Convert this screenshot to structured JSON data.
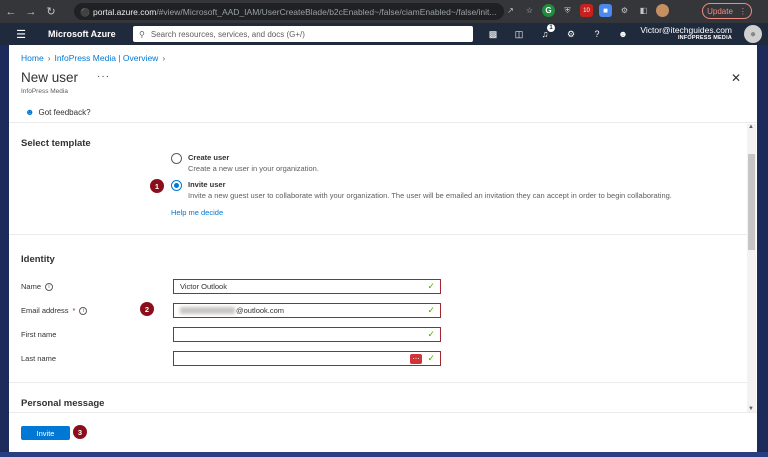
{
  "browser": {
    "url_host": "portal.azure.com",
    "url_path": "/#view/Microsoft_AAD_IAM/UserCreateBlade/b2cEnabled~/false/ciamEnabled~/false/init...",
    "update_label": "Update",
    "ext_badge": "10"
  },
  "azure": {
    "brand": "Microsoft Azure",
    "search_placeholder": "Search resources, services, and docs (G+/)",
    "notifications_count": "1",
    "account_email": "Victor@itechguides.com",
    "account_tenant": "INFOPRESS MEDIA"
  },
  "breadcrumb": [
    "Home",
    "InfoPress Media | Overview"
  ],
  "page": {
    "title": "New user",
    "subtitle": "InfoPress Media",
    "feedback_label": "Got feedback?"
  },
  "template": {
    "section_title": "Select template",
    "options": [
      {
        "label": "Create user",
        "description": "Create a new user in your organization.",
        "checked": false
      },
      {
        "label": "Invite user",
        "description": "Invite a new guest user to collaborate with your organization. The user will be emailed an invitation they can accept in order to begin collaborating.",
        "checked": true
      }
    ],
    "help_link": "Help me decide"
  },
  "identity": {
    "section_title": "Identity",
    "fields": [
      {
        "label": "Name",
        "value": "Victor Outlook",
        "info": true,
        "required": false
      },
      {
        "label": "Email address",
        "value": "@outlook.com",
        "info": true,
        "required": true
      },
      {
        "label": "First name",
        "value": "",
        "info": false,
        "required": false
      },
      {
        "label": "Last name",
        "value": "",
        "info": false,
        "required": false
      }
    ]
  },
  "personal_message": {
    "section_title": "Personal message"
  },
  "footer": {
    "invite_label": "Invite"
  },
  "steps": [
    "1",
    "2",
    "3"
  ],
  "colors": {
    "accent": "#0078d4",
    "error": "#a4262c",
    "step_badge": "#8b0f1a",
    "azure_bar": "#1f2a3c"
  }
}
